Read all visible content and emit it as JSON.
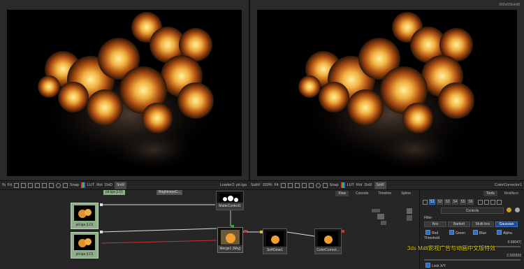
{
  "viewer_left": {
    "resolution": ""
  },
  "viewer_right": {
    "resolution": "900x506xint8"
  },
  "toolbar_left": {
    "zoom": "%",
    "fit": "Fit",
    "snap": "Snap",
    "lut": "LUT",
    "roi": "RoI",
    "dod": "DoD",
    "smr": "SmR",
    "title": "Loader2: pit.tga"
  },
  "toolbar_right": {
    "subv": "SubV",
    "zoom": "100%",
    "fit": "Fit",
    "snap": "Snap",
    "lut": "LUT",
    "roi": "RoI",
    "dod": "DoD",
    "smr": "SmR",
    "title": "ColorCorrector1"
  },
  "flow": {
    "tabs": [
      "Flow",
      "Console",
      "Timeline",
      "Spline"
    ],
    "active_tab": "Flow",
    "nodes": {
      "top_label": "pit.tga (LD)",
      "brightness_label": "BrightnessC...",
      "matte": "MatteControl1",
      "loader_a": "pit.tga (LD)",
      "loader_b": "pit.tga (LD)",
      "merge": "Merge1 (Mrg)",
      "softglow": "SoftGlow1",
      "colorcorrector": "ColorCorrect..."
    }
  },
  "controls": {
    "tabs": [
      "Tools",
      "Modifiers"
    ],
    "active_tab": "Tools",
    "channels": [
      "S1",
      "S2",
      "S3",
      "S4",
      "S5",
      "S6"
    ],
    "section": "Controls",
    "filter_label": "Filter",
    "filters": [
      "Box",
      "Bartlett",
      "Multi-box",
      "Gaussian"
    ],
    "active_filter": "Gaussian",
    "rgba": [
      "Red",
      "Green",
      "Blue",
      "Alpha"
    ],
    "threshold_label": "Threshold",
    "threshold_value": "0.99047¦",
    "second_value": "2.333333",
    "lock_label": "Lock X/Y",
    "watermark": "3ds Max影视广告与动画中文版特效"
  },
  "colors": {
    "accent_blue": "#2c6bc9",
    "node_green": "#8fae8a",
    "fire_orange": "#f0a030"
  }
}
